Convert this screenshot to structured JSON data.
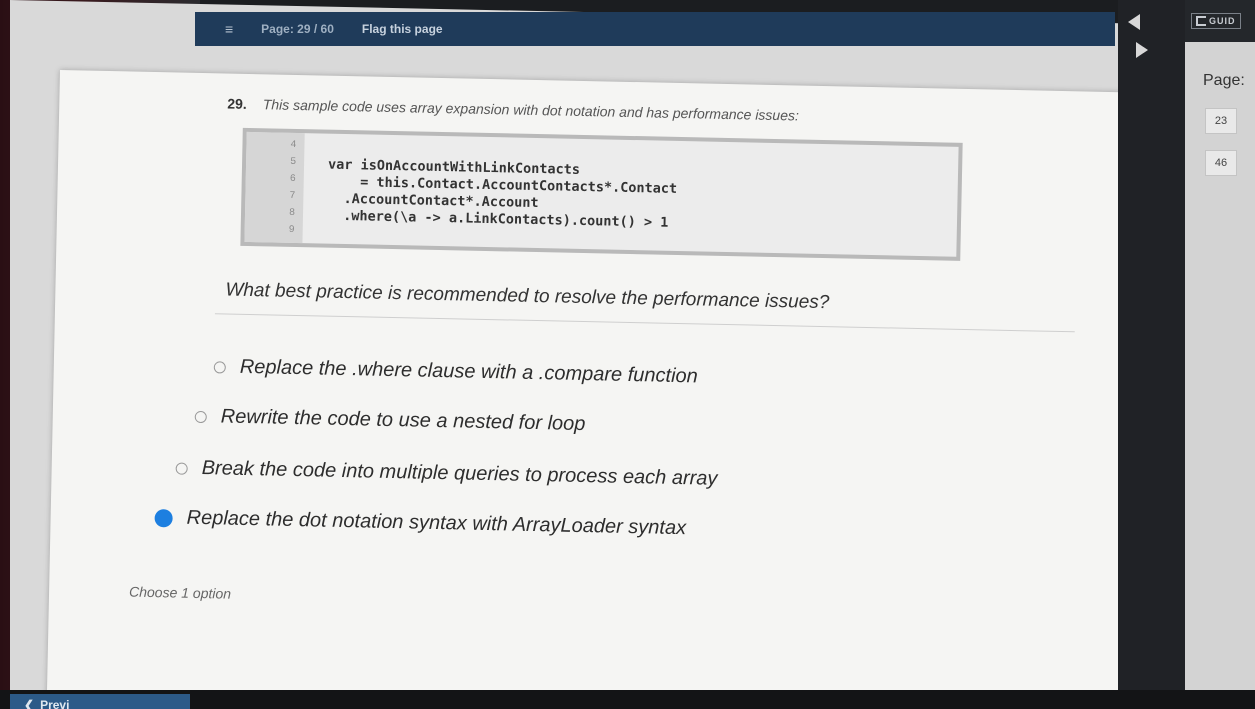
{
  "topbar": {
    "page_indicator": "Page: 29 / 60",
    "flag_label": "Flag this page"
  },
  "side_panel": {
    "logo_text": "GUID",
    "pages_label": "Page:",
    "page_buttons": [
      "23",
      "46"
    ]
  },
  "question": {
    "number": "29.",
    "intro": "This sample code uses array expansion with dot notation and has performance issues:",
    "code_line_numbers": [
      "4",
      "5",
      "6",
      "7",
      "8",
      "9"
    ],
    "code_lines": [
      "",
      "var isOnAccountWithLinkContacts",
      "    = this.Contact.AccountContacts*.Contact",
      "  .AccountContact*.Account",
      "  .where(\\a -> a.LinkContacts).count() > 1",
      ""
    ],
    "prompt": "What best practice is recommended to resolve the performance issues?",
    "options": [
      {
        "label": "Replace the .where clause with a .compare function",
        "selected": false
      },
      {
        "label": "Rewrite the code to use a nested for loop",
        "selected": false
      },
      {
        "label": "Break the code into multiple queries to process each array",
        "selected": false
      },
      {
        "label": "Replace the dot notation syntax with ArrayLoader syntax",
        "selected": true
      }
    ],
    "hint": "Choose 1 option"
  },
  "footer": {
    "prev_label": "Previ"
  },
  "colors": {
    "topbar": "#1f3b5a",
    "selected_radio": "#1d7fe0",
    "keyword": "#2b3ea8"
  }
}
